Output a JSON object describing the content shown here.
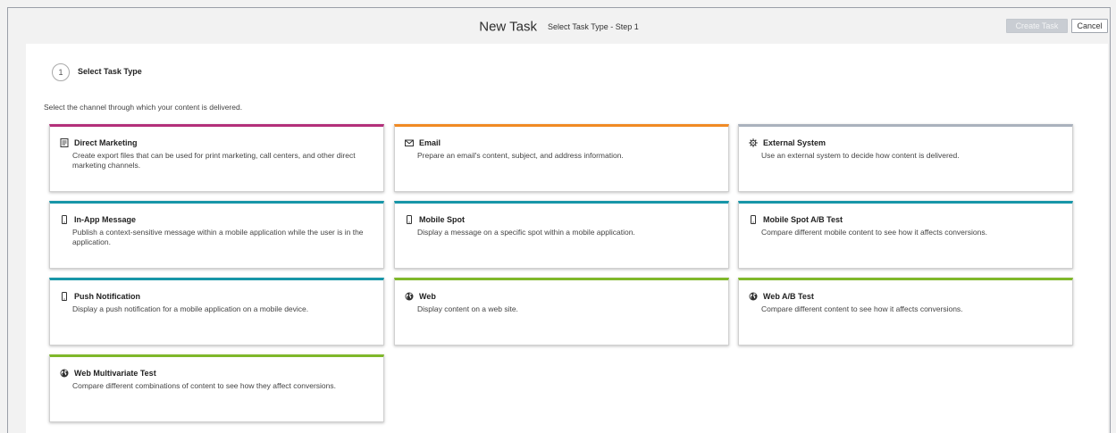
{
  "header": {
    "title": "New Task",
    "step_label": "Select Task Type - Step 1",
    "create_button": "Create Task",
    "cancel_button": "Cancel"
  },
  "step": {
    "number": "1",
    "label": "Select Task Type"
  },
  "intro": "Select the channel through which your content is delivered.",
  "colors": {
    "direct_marketing": "#b3307a",
    "email": "#f08a24",
    "external": "#aab2bd",
    "mobile": "#1796a8",
    "web": "#7fb82a",
    "create_disabled": "#c9cdd3"
  },
  "cards": [
    {
      "title": "Direct Marketing",
      "desc": "Create export files that can be used for print marketing, call centers, and other direct marketing channels.",
      "icon": "document-icon",
      "color": "direct_marketing"
    },
    {
      "title": "Email",
      "desc": "Prepare an email's content, subject, and address information.",
      "icon": "envelope-icon",
      "color": "email"
    },
    {
      "title": "External System",
      "desc": "Use an external system to decide how content is delivered.",
      "icon": "gear-icon",
      "color": "external"
    },
    {
      "title": "In-App Message",
      "desc": "Publish a context-sensitive message within a mobile application while the user is in the application.",
      "icon": "mobile-icon",
      "color": "mobile"
    },
    {
      "title": "Mobile Spot",
      "desc": "Display a message on a specific spot within a mobile application.",
      "icon": "mobile-icon",
      "color": "mobile"
    },
    {
      "title": "Mobile Spot A/B Test",
      "desc": "Compare different mobile content to see how it affects conversions.",
      "icon": "mobile-icon",
      "color": "mobile"
    },
    {
      "title": "Push Notification",
      "desc": "Display a push notification for a mobile application on a mobile device.",
      "icon": "mobile-icon",
      "color": "mobile"
    },
    {
      "title": "Web",
      "desc": "Display content on a web site.",
      "icon": "globe-icon",
      "color": "web"
    },
    {
      "title": "Web A/B Test",
      "desc": "Compare different content to see how it affects conversions.",
      "icon": "globe-icon",
      "color": "web"
    },
    {
      "title": "Web Multivariate Test",
      "desc": "Compare different combinations of content to see how they affect conversions.",
      "icon": "globe-icon",
      "color": "web"
    }
  ]
}
